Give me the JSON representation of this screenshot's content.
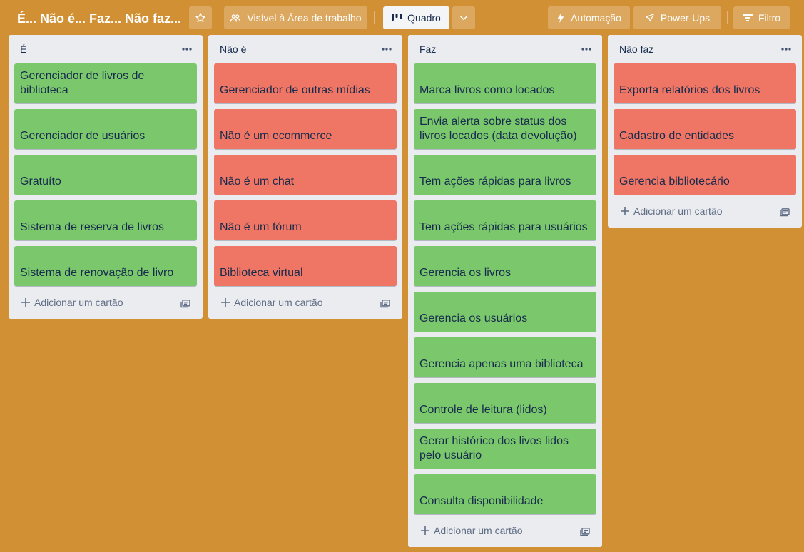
{
  "board": {
    "title": "É... Não é... Faz... Não faz...",
    "visibility_label": "Visível à Área de trabalho",
    "view_label": "Quadro",
    "automation_label": "Automação",
    "powerups_label": "Power-Ups",
    "filter_label": "Filtro"
  },
  "colors": {
    "background": "#d29034",
    "card_green": "#7bc86c",
    "card_red": "#ef7564",
    "list_bg": "#ebecf0"
  },
  "lists": [
    {
      "title": "É",
      "add_card_label": "Adicionar um cartão",
      "cards": [
        {
          "text": "Gerenciador de livros de biblioteca",
          "color": "green"
        },
        {
          "text": "Gerenciador de usuários",
          "color": "green"
        },
        {
          "text": "Gratuíto",
          "color": "green"
        },
        {
          "text": "Sistema de reserva de livros",
          "color": "green"
        },
        {
          "text": "Sistema de renovação de livro",
          "color": "green"
        }
      ]
    },
    {
      "title": "Não é",
      "add_card_label": "Adicionar um cartão",
      "cards": [
        {
          "text": "Gerenciador de outras mídias",
          "color": "red"
        },
        {
          "text": "Não é um ecommerce",
          "color": "red"
        },
        {
          "text": "Não é um chat",
          "color": "red"
        },
        {
          "text": "Não é um fórum",
          "color": "red"
        },
        {
          "text": "Biblioteca virtual",
          "color": "red"
        }
      ]
    },
    {
      "title": "Faz",
      "add_card_label": "Adicionar um cartão",
      "cards": [
        {
          "text": "Marca livros como locados",
          "color": "green"
        },
        {
          "text": "Envia alerta sobre status dos livros locados (data devolução)",
          "color": "green"
        },
        {
          "text": "Tem ações rápidas para livros",
          "color": "green"
        },
        {
          "text": "Tem ações rápidas para usuários",
          "color": "green"
        },
        {
          "text": "Gerencia os livros",
          "color": "green"
        },
        {
          "text": "Gerencia os usuários",
          "color": "green"
        },
        {
          "text": "Gerencia apenas uma biblioteca",
          "color": "green"
        },
        {
          "text": "Controle de leitura (lidos)",
          "color": "green"
        },
        {
          "text": "Gerar histórico dos livos lidos pelo usuário",
          "color": "green"
        },
        {
          "text": "Consulta disponibilidade",
          "color": "green"
        }
      ]
    },
    {
      "title": "Não faz",
      "add_card_label": "Adicionar um cartão",
      "cards": [
        {
          "text": "Exporta relatórios dos livros",
          "color": "red"
        },
        {
          "text": "Cadastro de entidades",
          "color": "red"
        },
        {
          "text": "Gerencia bibliotecário",
          "color": "red"
        }
      ]
    }
  ]
}
